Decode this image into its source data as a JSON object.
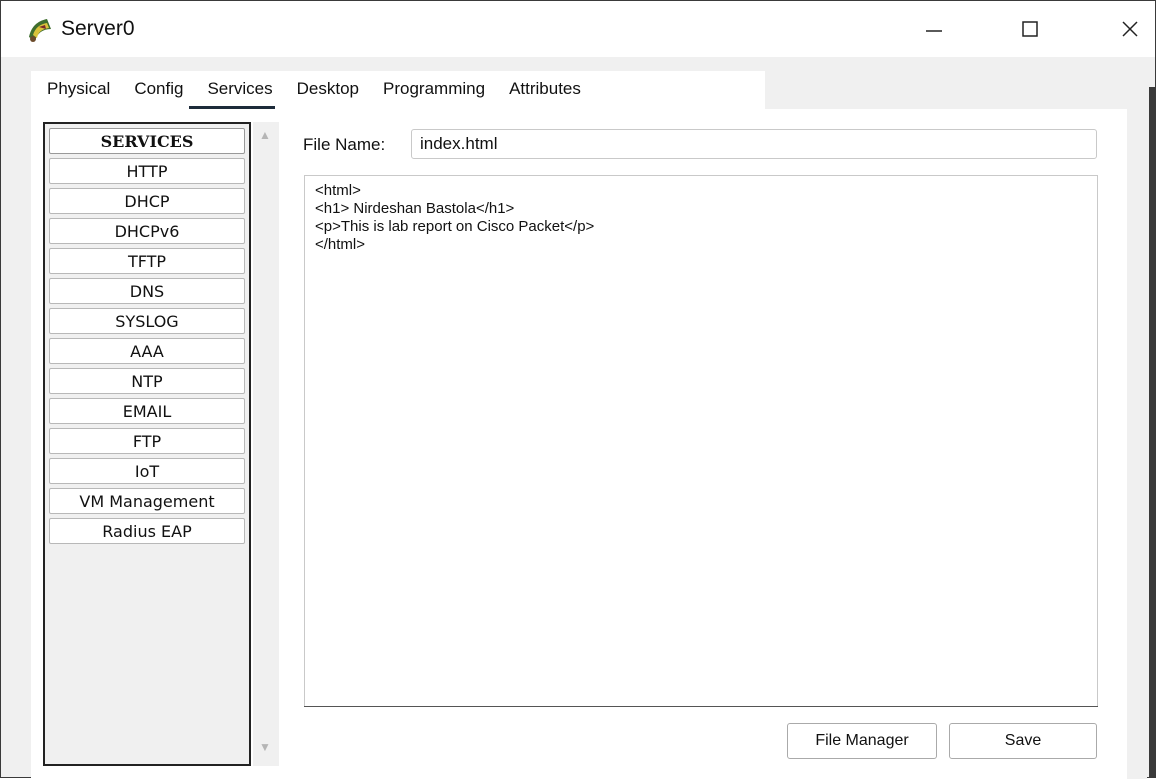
{
  "window": {
    "title": "Server0",
    "controls": {
      "minimize": "—",
      "maximize": "□",
      "close": "✕"
    }
  },
  "tabs": [
    {
      "label": "Physical",
      "active": false
    },
    {
      "label": "Config",
      "active": false
    },
    {
      "label": "Services",
      "active": true
    },
    {
      "label": "Desktop",
      "active": false
    },
    {
      "label": "Programming",
      "active": false
    },
    {
      "label": "Attributes",
      "active": false
    }
  ],
  "services": {
    "header": "SERVICES",
    "items": [
      "HTTP",
      "DHCP",
      "DHCPv6",
      "TFTP",
      "DNS",
      "SYSLOG",
      "AAA",
      "NTP",
      "EMAIL",
      "FTP",
      "IoT",
      "VM Management",
      "Radius EAP"
    ]
  },
  "http": {
    "file_name_label": "File Name:",
    "file_name_value": "index.html",
    "editor_content": "<html>\n<h1> Nirdeshan Bastola</h1>\n<p>This is lab report on Cisco Packet</p>\n</html>",
    "file_manager_button": "File Manager",
    "save_button": "Save"
  },
  "icons": {
    "app": "server-app-icon",
    "scroll_up": "scroll-up-arrow-icon",
    "scroll_down": "scroll-down-arrow-icon"
  },
  "colors": {
    "tab_underline": "#1d2b3a",
    "window_bg": "#f0f0f0"
  }
}
